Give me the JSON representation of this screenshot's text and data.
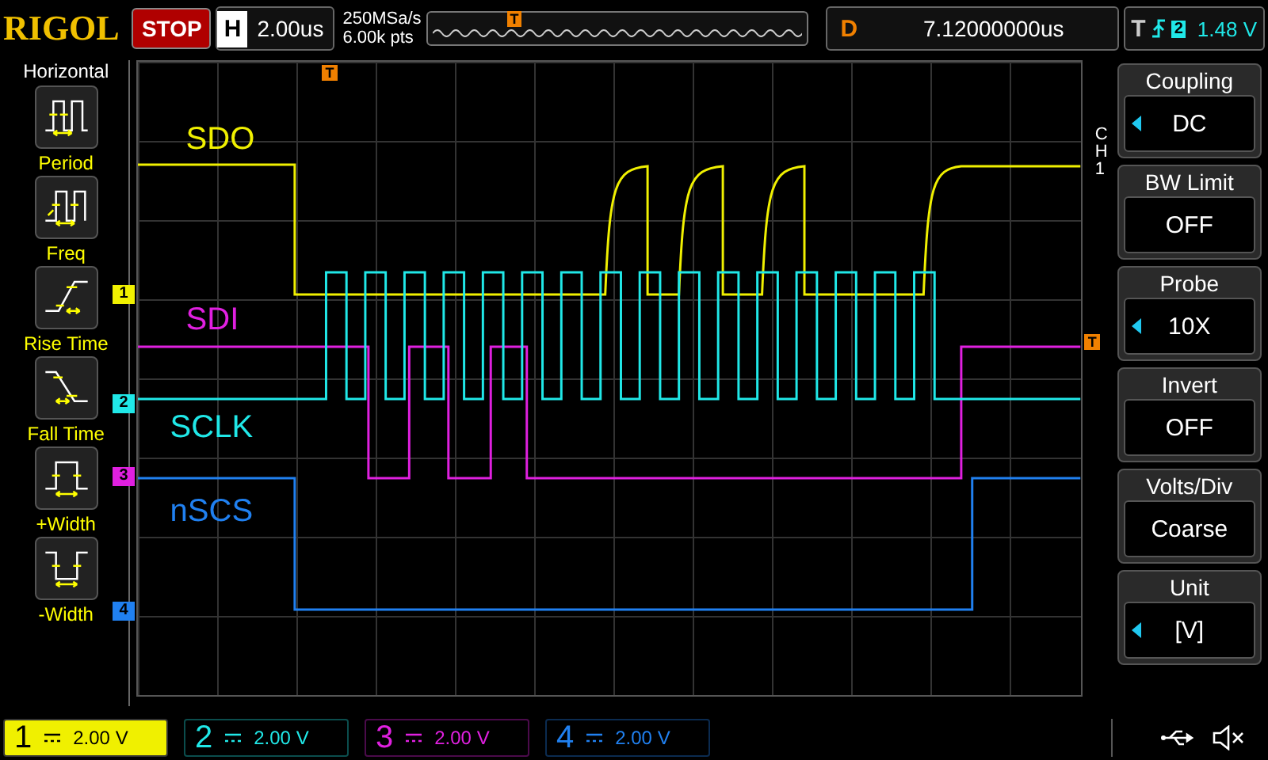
{
  "header": {
    "brand": "RIGOL",
    "run_state": "STOP",
    "horizontal": {
      "label": "H",
      "value": "2.00us"
    },
    "sample_rate": "250MSa/s",
    "memory_depth": "6.00k pts",
    "trigger_position": "T",
    "delay": {
      "label": "D",
      "value": "7.12000000us"
    },
    "trigger": {
      "label": "T",
      "source": "2",
      "level": "1.48 V"
    }
  },
  "left_menu": {
    "title": "Horizontal",
    "items": [
      {
        "kind": "period",
        "label": "Period"
      },
      {
        "kind": "freq",
        "label": "Freq"
      },
      {
        "kind": "rise",
        "label": "Rise Time"
      },
      {
        "kind": "fall",
        "label": "Fall Time"
      },
      {
        "kind": "pwidth",
        "label": "+Width"
      },
      {
        "kind": "nwidth",
        "label": "-Width"
      }
    ]
  },
  "traces": [
    {
      "name": "SDO",
      "color": "#f0f000"
    },
    {
      "name": "SDI",
      "color": "#e020e0"
    },
    {
      "name": "SCLK",
      "color": "#20e8e8"
    },
    {
      "name": "nSCS",
      "color": "#2080f0"
    }
  ],
  "channel_markers": [
    "1",
    "2",
    "3",
    "4"
  ],
  "trigger_markers": [
    "T",
    "T"
  ],
  "right_menu": {
    "channel": "CH1",
    "items": [
      {
        "title": "Coupling",
        "value": "DC",
        "arrow": true
      },
      {
        "title": "BW Limit",
        "value": "OFF",
        "arrow": false
      },
      {
        "title": "Probe",
        "value": "10X",
        "arrow": true
      },
      {
        "title": "Invert",
        "value": "OFF",
        "arrow": false
      },
      {
        "title": "Volts/Div",
        "value": "Coarse",
        "arrow": false
      },
      {
        "title": "Unit",
        "value": "[V]",
        "arrow": true
      }
    ]
  },
  "channels": [
    {
      "number": "1",
      "scale": "2.00 V",
      "selected": true,
      "color": "#f0f000"
    },
    {
      "number": "2",
      "scale": "2.00 V",
      "selected": false,
      "color": "#20e8e8"
    },
    {
      "number": "3",
      "scale": "2.00 V",
      "selected": false,
      "color": "#e020e0"
    },
    {
      "number": "4",
      "scale": "2.00 V",
      "selected": false,
      "color": "#2080f0"
    }
  ]
}
